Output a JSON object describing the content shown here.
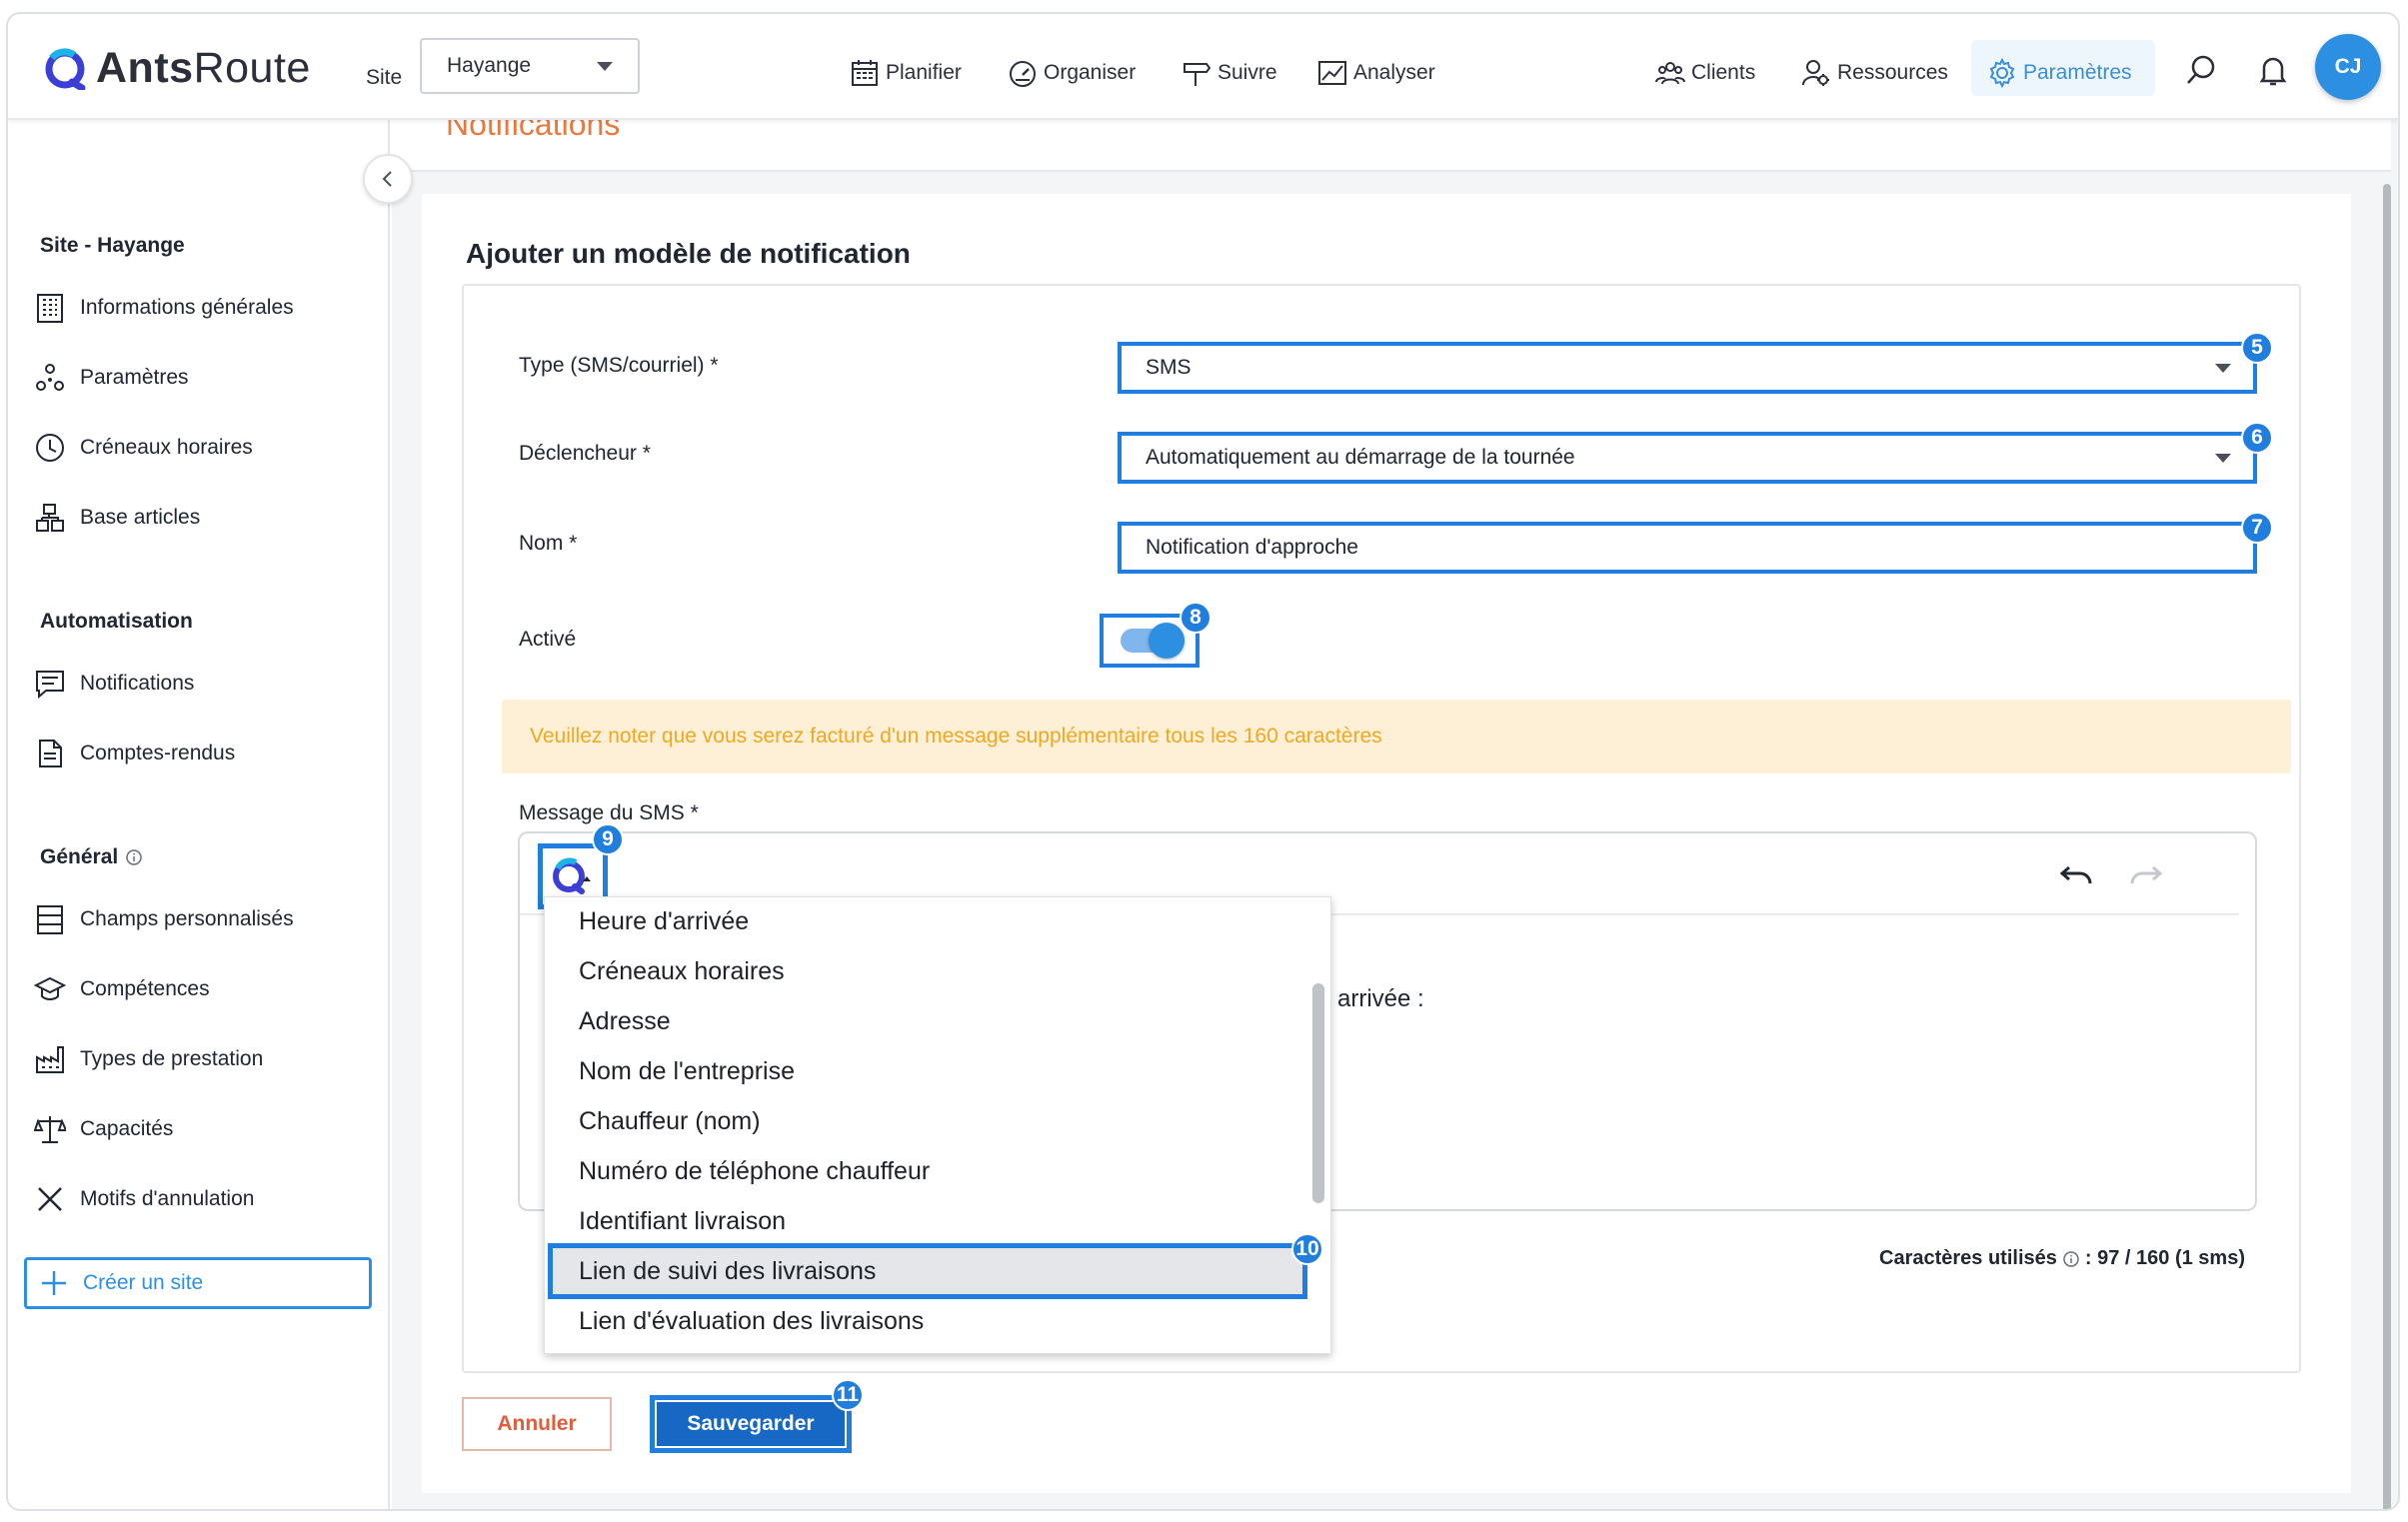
{
  "app": {
    "logo_text_bold": "Ants",
    "logo_text_light": "Route"
  },
  "header": {
    "site_label": "Site",
    "site_value": "Hayange",
    "nav": [
      {
        "label": "Planifier",
        "icon": "calendar-icon"
      },
      {
        "label": "Organiser",
        "icon": "gauge-icon"
      },
      {
        "label": "Suivre",
        "icon": "signpost-icon"
      },
      {
        "label": "Analyser",
        "icon": "chart-icon"
      }
    ],
    "right_nav": [
      {
        "label": "Clients",
        "icon": "users-icon"
      },
      {
        "label": "Ressources",
        "icon": "user-gear-icon"
      },
      {
        "label": "Paramètres",
        "icon": "gear-icon",
        "active": true
      }
    ],
    "avatar_initials": "CJ"
  },
  "sidebar": {
    "section_site": "Site - Hayange",
    "site_items": [
      {
        "label": "Informations générales",
        "icon": "building-icon"
      },
      {
        "label": "Paramètres",
        "icon": "nodes-icon"
      },
      {
        "label": "Créneaux horaires",
        "icon": "clock-icon"
      },
      {
        "label": "Base articles",
        "icon": "boxes-icon"
      }
    ],
    "section_auto": "Automatisation",
    "auto_items": [
      {
        "label": "Notifications",
        "icon": "message-icon"
      },
      {
        "label": "Comptes-rendus",
        "icon": "document-icon"
      }
    ],
    "section_general": "Général",
    "general_items": [
      {
        "label": "Champs personnalisés",
        "icon": "fields-icon"
      },
      {
        "label": "Compétences",
        "icon": "graduation-icon"
      },
      {
        "label": "Types de prestation",
        "icon": "factory-icon"
      },
      {
        "label": "Capacités",
        "icon": "scale-icon"
      },
      {
        "label": "Motifs d'annulation",
        "icon": "x-icon"
      }
    ],
    "create_site": "Créer un site"
  },
  "main": {
    "page_title": "Notifications",
    "form_heading": "Ajouter un modèle de notification",
    "fields": {
      "type_label": "Type (SMS/courriel) *",
      "type_value": "SMS",
      "trigger_label": "Déclencheur *",
      "trigger_value": "Automatiquement au démarrage de la tournée",
      "name_label": "Nom *",
      "name_value": "Notification d'approche",
      "active_label": "Activé",
      "active_on": true
    },
    "warning": "Veuillez noter que vous serez facturé d'un message supplémentaire tous les 160 caractères",
    "message_label": "Message du SMS *",
    "editor_visible_text": "arrivée :",
    "dropdown_items": [
      "Heure d'arrivée",
      "Créneaux horaires",
      "Adresse",
      "Nom de l'entreprise",
      "Chauffeur (nom)",
      "Numéro de téléphone chauffeur",
      "Identifiant livraison",
      "Lien de suivi des livraisons",
      "Lien d'évaluation des livraisons"
    ],
    "highlighted_item": "Lien de suivi des livraisons",
    "chars_label": "Caractères utilisés",
    "chars_value": ": 97 / 160 (1 sms)",
    "cancel": "Annuler",
    "save": "Sauvegarder"
  },
  "annotations": {
    "b5": "5",
    "b6": "6",
    "b7": "7",
    "b8": "8",
    "b9": "9",
    "b10": "10",
    "b11": "11"
  },
  "colors": {
    "accent": "#2d8fe2",
    "annotation": "#1f7ede",
    "title": "#e87a3e",
    "warning_bg": "#fdf0d7",
    "warning_text": "#f0a820"
  }
}
